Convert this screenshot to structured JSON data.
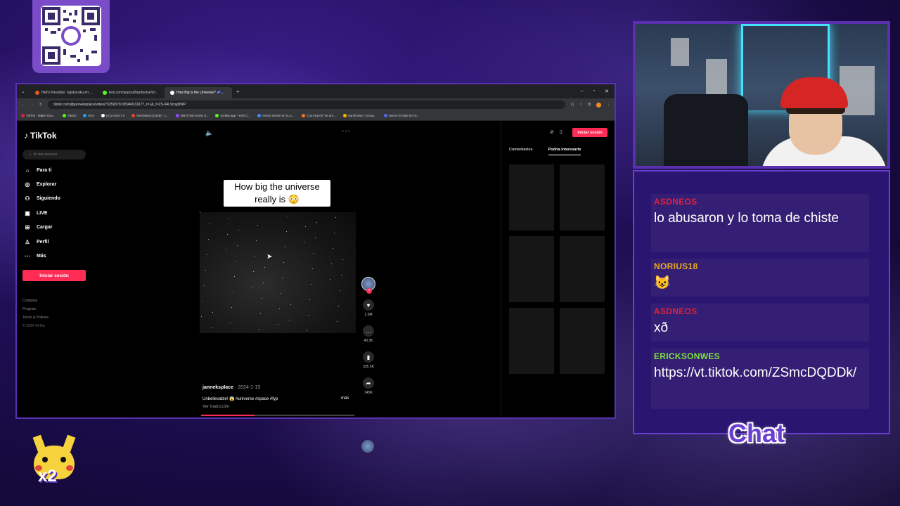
{
  "browser": {
    "tabs": [
      {
        "title": "Hell's Paradise: Jigokuraku en ...",
        "color": "#e4571f"
      },
      {
        "title": "kick.com/popout/hqrdnoise/ch...",
        "color": "#53fc18"
      },
      {
        "title": "How Big is the Universe? 🌌...",
        "color": "#ffffff"
      }
    ],
    "url": "tiktok.com/@jannekspIace/video/7325937819594063167?_r=1&_t=ZS-94L9coyj9WP",
    "bookmarks": [
      "TikTok - Make Your...",
      "Twitch",
      "Kick",
      "(21) Inicio / X",
      "Recibidos (3,628) - c...",
      "twitch bits botón d...",
      "Kicklet.app - Kick C...",
      "Iniciar sesión en su c...",
      "Crunchyroll: Ve ani...",
      "HqrdNoise | Group...",
      "Dance Emojis for Di..."
    ]
  },
  "tiktok": {
    "logo": "TikTok",
    "search_placeholder": "fin del universo",
    "nav": [
      {
        "label": "Para ti",
        "icon": "home-icon",
        "glyph": "⌂"
      },
      {
        "label": "Explorar",
        "icon": "compass-icon",
        "glyph": "◎"
      },
      {
        "label": "Siguiendo",
        "icon": "following-icon",
        "glyph": "⚇"
      },
      {
        "label": "LIVE",
        "icon": "live-icon",
        "glyph": "▣"
      },
      {
        "label": "Cargar",
        "icon": "upload-icon",
        "glyph": "⊞"
      },
      {
        "label": "Perfil",
        "icon": "profile-icon",
        "glyph": "♙"
      },
      {
        "label": "Más",
        "icon": "more-icon",
        "glyph": "···"
      }
    ],
    "login_button": "Iniciar sesión",
    "footer": [
      "Company",
      "Program",
      "Terms & Policies"
    ],
    "copyright": "© 2024 TikTok",
    "video_caption": "How big the universe really is 😳",
    "likes": "2.5M",
    "comments": "43.3K",
    "saves": "335.5K",
    "shares": "145K",
    "author": "jannekspIace",
    "date": " · 2024-1-19",
    "description": "Unbelievable! 😱 #universe #space #fyp",
    "translate": "Ver traducción",
    "more": "más",
    "progress": 0.35,
    "login_small": "Iniciar sesión",
    "right_tabs": [
      "Comentarios",
      "Podría interesarte"
    ],
    "accent": "#fe2c55"
  },
  "chat": {
    "label": "Chat",
    "messages": [
      {
        "user": "ASDNEOS",
        "user_color": "#e0213b",
        "text": "lo abusaron y lo toma de chiste"
      },
      {
        "user": "NORIUS18",
        "user_color": "#e9a825",
        "text": "😺"
      },
      {
        "user": "ASDNEOS",
        "user_color": "#e0213b",
        "text": "xð"
      },
      {
        "user": "ERICKSONWES",
        "user_color": "#7ee33f",
        "text": "https://vt.tiktok.com/ZSmcDQDDk/"
      }
    ]
  },
  "overlay": {
    "multiplier": "x2"
  }
}
